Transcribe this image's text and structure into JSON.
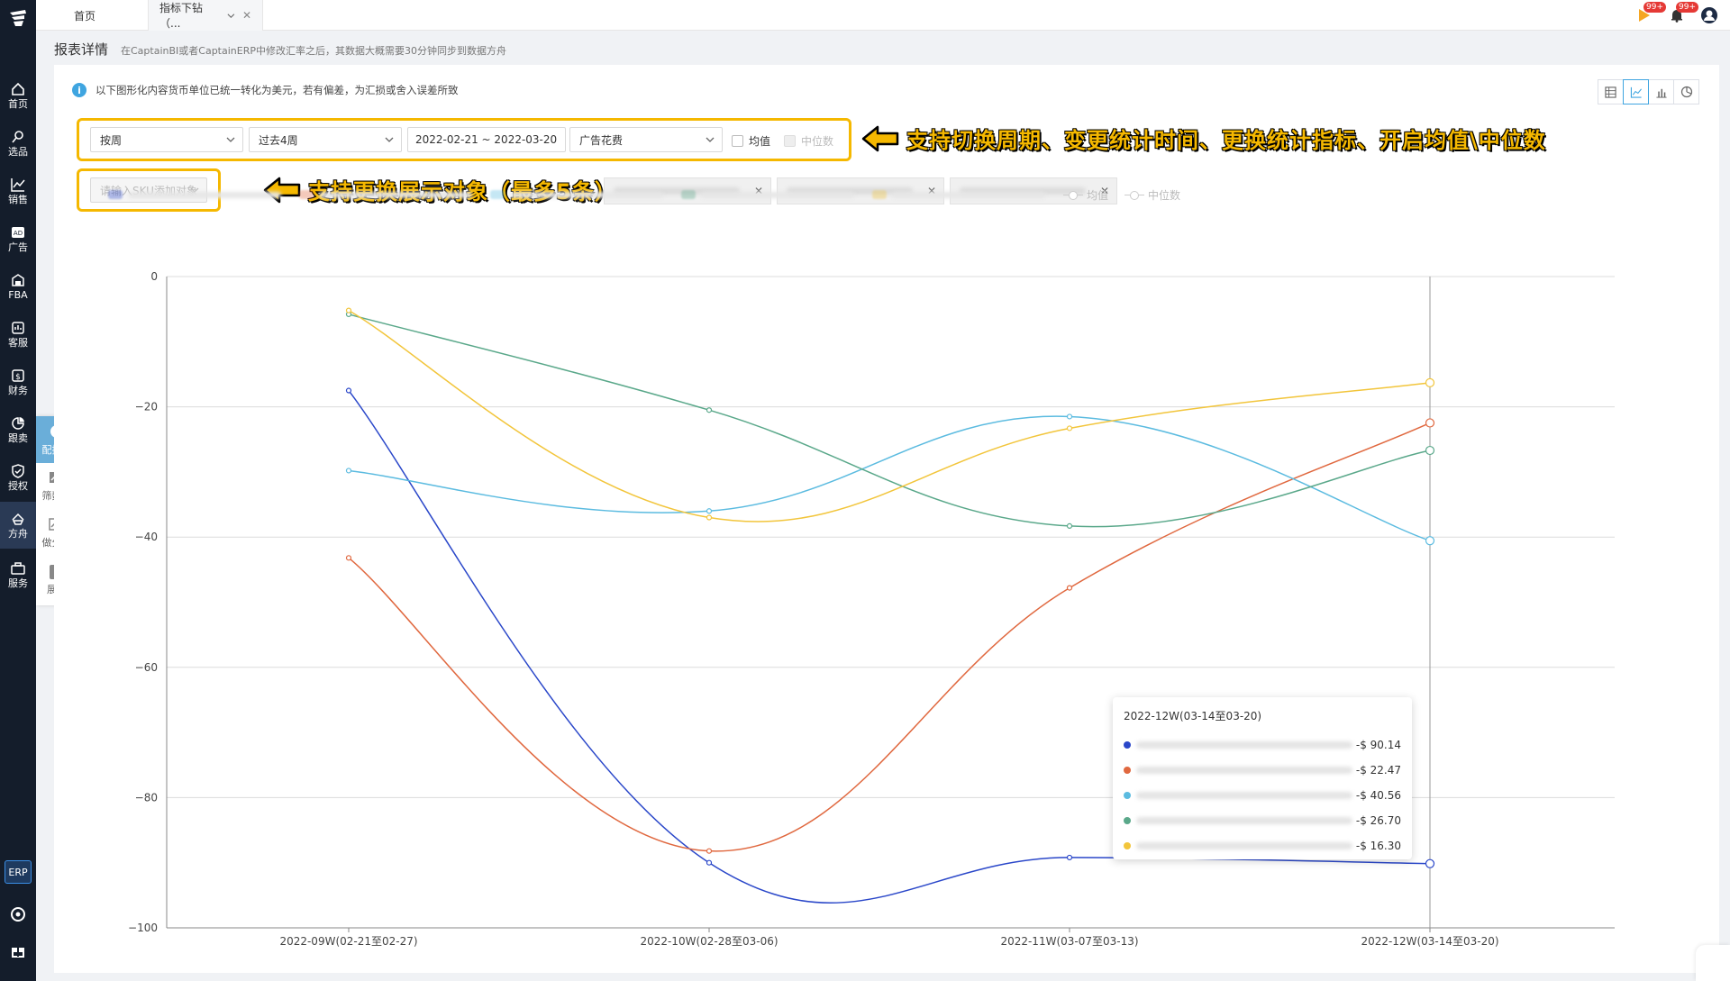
{
  "nav": {
    "items": [
      {
        "label": "首页",
        "icon": "home-icon"
      },
      {
        "label": "选品",
        "icon": "search-icon"
      },
      {
        "label": "销售",
        "icon": "trend-icon"
      },
      {
        "label": "广告",
        "icon": "ad-icon"
      },
      {
        "label": "FBA",
        "icon": "warehouse-icon"
      },
      {
        "label": "客服",
        "icon": "service-icon"
      },
      {
        "label": "财务",
        "icon": "finance-icon"
      },
      {
        "label": "跟卖",
        "icon": "pie-icon"
      },
      {
        "label": "授权",
        "icon": "shield-icon"
      },
      {
        "label": "方舟",
        "icon": "ark-icon"
      },
      {
        "label": "服务",
        "icon": "briefcase-icon"
      }
    ],
    "erp_label": "ERP"
  },
  "subpanel": {
    "items": [
      {
        "label": "配报表"
      },
      {
        "label": "筛数据"
      },
      {
        "label": "做分析"
      },
      {
        "label": "展开"
      }
    ]
  },
  "tabs": [
    {
      "label": "首页"
    },
    {
      "label": "指标下钻（..."
    }
  ],
  "top_badges": {
    "flag": "99+",
    "bell": "99+"
  },
  "page": {
    "title": "报表详情",
    "subtitle": "在CaptainBI或者CaptainERP中修改汇率之后，其数据大概需要30分钟同步到数据方舟",
    "info": "以下图形化内容货币单位已统一转化为美元，若有偏差，为汇损或舍入误差所致"
  },
  "filters": {
    "period": "按周",
    "range": "过去4周",
    "date_range": "2022-02-21 ~ 2022-03-20",
    "metric": "广告花费",
    "avg_label": "均值",
    "median_label": "中位数",
    "sku_placeholder": "请输入SKU添加对象"
  },
  "callouts": {
    "top": "支持切换周期、变更统计时间、更换统计指标、开启均值\\中位数",
    "bottom": "支持更换展示对象（最多5条）"
  },
  "legend": {
    "avg": "均值",
    "median": "中位数"
  },
  "colors": {
    "blue": "#2a47c9",
    "orange": "#e0683f",
    "cyan": "#5bbbe0",
    "green": "#5aa88a",
    "yellow": "#f2c53b",
    "accent": "#3fa5e0",
    "highlight": "#f5b800"
  },
  "chart_data": {
    "type": "line",
    "x": [
      "2022-09W(02-21至02-27)",
      "2022-10W(02-28至03-06)",
      "2022-11W(03-07至03-13)",
      "2022-12W(03-14至03-20)"
    ],
    "ylim": [
      -100,
      0
    ],
    "yticks": [
      0,
      -20,
      -40,
      -60,
      -80,
      -100
    ],
    "grid": true,
    "series": [
      {
        "color": "blue",
        "values": [
          -17.5,
          -90.0,
          -89.2,
          -90.14
        ]
      },
      {
        "color": "orange",
        "values": [
          -43.2,
          -88.2,
          -47.8,
          -22.47
        ]
      },
      {
        "color": "cyan",
        "values": [
          -29.8,
          -36.0,
          -21.5,
          -40.56
        ]
      },
      {
        "color": "green",
        "values": [
          -5.8,
          -20.5,
          -38.3,
          -26.7
        ]
      },
      {
        "color": "yellow",
        "values": [
          -5.2,
          -37.0,
          -23.3,
          -16.3
        ]
      }
    ]
  },
  "tooltip": {
    "title": "2022-12W(03-14至03-20)",
    "rows": [
      {
        "color": "blue",
        "value": "-$ 90.14"
      },
      {
        "color": "orange",
        "value": "-$ 22.47"
      },
      {
        "color": "cyan",
        "value": "-$ 40.56"
      },
      {
        "color": "green",
        "value": "-$ 26.70"
      },
      {
        "color": "yellow",
        "value": "-$ 16.30"
      }
    ]
  }
}
